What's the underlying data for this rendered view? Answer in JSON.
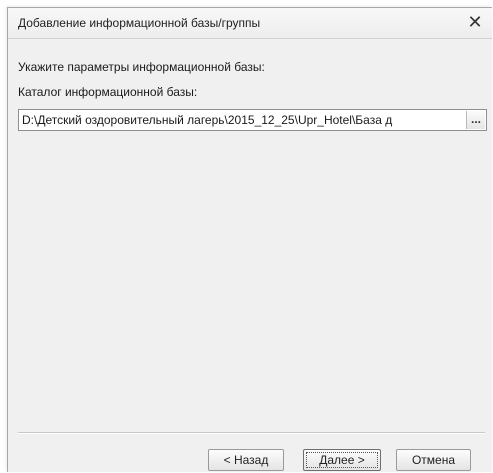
{
  "window": {
    "title": "Добавление информационной базы/группы",
    "close_glyph": "✕",
    "close_icon": "close-icon"
  },
  "form": {
    "params_label": "Укажите параметры информационной базы:",
    "catalog_label": "Каталог информационной базы:",
    "catalog_value": "D:\\Детский оздоровительный лагерь\\2015_12_25\\Upr_Hotel\\База д",
    "browse_label": "..."
  },
  "buttons": {
    "back": "< Назад",
    "next": "Далее >",
    "cancel": "Отмена"
  }
}
